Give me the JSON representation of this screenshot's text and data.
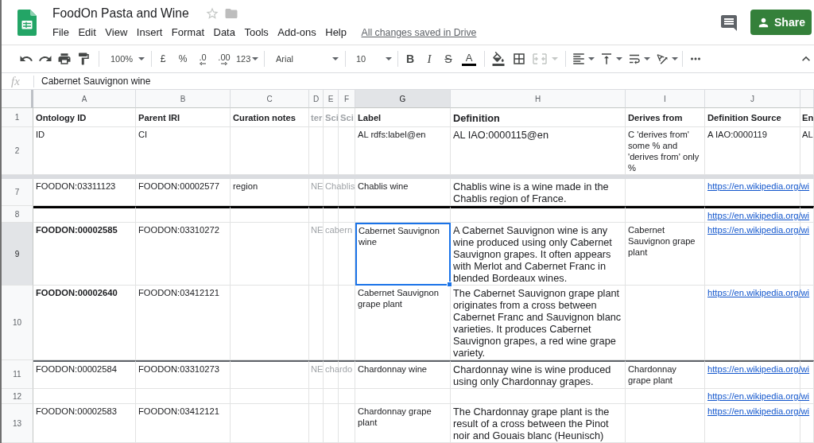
{
  "document": {
    "title": "FoodOn Pasta and Wine",
    "starred": false,
    "menu": [
      "File",
      "Edit",
      "View",
      "Insert",
      "Format",
      "Data",
      "Tools",
      "Add-ons",
      "Help"
    ],
    "save_status": "All changes saved in Drive"
  },
  "share_button": {
    "label": "Share"
  },
  "toolbar": {
    "zoom": "100%",
    "currency": "£",
    "percent": "%",
    "decrease_decimal": ".0",
    "increase_decimal": ".00",
    "number_format": "123",
    "font": "Arial",
    "font_size": "10",
    "bold": "B",
    "italic": "I",
    "strikethrough": "S",
    "text_color": "A",
    "merge_disabled": true
  },
  "formula_bar": {
    "label": "fx",
    "value": "Cabernet Sauvignon wine"
  },
  "sheet": {
    "columns": [
      {
        "letter": "A",
        "selected": false
      },
      {
        "letter": "B",
        "selected": false
      },
      {
        "letter": "C",
        "selected": false
      },
      {
        "letter": "D",
        "selected": false
      },
      {
        "letter": "E",
        "selected": false
      },
      {
        "letter": "F",
        "selected": false
      },
      {
        "letter": "G",
        "selected": true
      },
      {
        "letter": "H",
        "selected": false
      },
      {
        "letter": "I",
        "selected": false
      },
      {
        "letter": "J",
        "selected": false
      },
      {
        "selected": false
      }
    ],
    "rows": [
      {
        "number": "1",
        "selected": false,
        "kind": "header",
        "frozen_split_above": false,
        "heavy_border_above": false,
        "medium_border_above": false,
        "cells": {
          "a": "Ontology ID",
          "b": "Parent IRI",
          "c": "Curation notes",
          "d": {
            "text": "ter",
            "muted": true
          },
          "e": {
            "text": "Sci",
            "muted": true
          },
          "f": {
            "text": "Sci",
            "muted": true
          },
          "g": "Label",
          "h": "Definition",
          "i": "Derives from",
          "j": "Definition Source",
          "k": "En"
        }
      },
      {
        "number": "2",
        "selected": false,
        "kind": "data",
        "frozen_split_above": false,
        "heavy_border_above": false,
        "medium_border_above": false,
        "cells": {
          "a": "ID",
          "b": "CI",
          "g": "AL rdfs:label@en",
          "h": "AL IAO:0000115@en",
          "i": "C 'derives from' some % and 'derives from' only %",
          "j": "A IAO:0000119",
          "k": "AL"
        }
      },
      {
        "number": "7",
        "selected": false,
        "kind": "data",
        "frozen_split_above": true,
        "heavy_border_above": false,
        "medium_border_above": false,
        "cells": {
          "a": "FOODON:03311123",
          "b": "FOODON:00002577",
          "c": "region",
          "d": {
            "text": "NE",
            "muted": true
          },
          "e": {
            "text": "Chablis",
            "muted": true
          },
          "g": "Chablis wine",
          "h": "Chablis wine is a wine made in the Chablis region of France.",
          "j": {
            "text": "https://en.wikipedia.org/wi",
            "link": true
          }
        }
      },
      {
        "number": "8",
        "selected": false,
        "kind": "data",
        "frozen_split_above": false,
        "heavy_border_above": true,
        "medium_border_above": false,
        "cells": {
          "j": {
            "text": "https://en.wikipedia.org/wi",
            "link": true
          }
        }
      },
      {
        "number": "9",
        "selected": true,
        "kind": "data",
        "frozen_split_above": false,
        "heavy_border_above": false,
        "medium_border_above": false,
        "cells": {
          "a": {
            "text": "FOODON:00002585",
            "bold": true
          },
          "b": "FOODON:03310272",
          "d": {
            "text": "NE",
            "muted": true
          },
          "e": {
            "text": "cabern",
            "muted": true
          },
          "g": "Cabernet Sauvignon wine",
          "h": "A Cabernet Sauvignon wine is any wine produced using only Cabernet Sauvignon grapes. It often appears with Merlot and Cabernet Franc in blended Bordeaux wines.",
          "i": "Cabernet Sauvignon grape plant",
          "j": {
            "text": "https://en.wikipedia.org/wi",
            "link": true
          }
        }
      },
      {
        "number": "10",
        "selected": false,
        "kind": "data",
        "frozen_split_above": false,
        "heavy_border_above": false,
        "medium_border_above": false,
        "cells": {
          "a": {
            "text": "FOODON:00002640",
            "bold": true
          },
          "b": "FOODON:03412121",
          "g": "Cabernet Sauvignon grape plant",
          "h": "The Cabernet Sauvignon grape plant originates from a cross between Cabernet Franc and Sauvignon blanc varieties. It produces Cabernet Sauvignon grapes, a red wine grape variety.",
          "j": {
            "text": "https://en.wikipedia.org/wi",
            "link": true
          }
        }
      },
      {
        "number": "11",
        "selected": false,
        "kind": "data",
        "frozen_split_above": false,
        "heavy_border_above": false,
        "medium_border_above": true,
        "cells": {
          "a": "FOODON:00002584",
          "b": "FOODON:03310273",
          "d": {
            "text": "NE",
            "muted": true
          },
          "e": {
            "text": "chardo",
            "muted": true
          },
          "g": "Chardonnay wine",
          "h": "Chardonnay wine is wine produced using only Chardonnay grapes.",
          "i": "Chardonnay grape plant",
          "j": {
            "text": "https://en.wikipedia.org/wi",
            "link": true
          }
        }
      },
      {
        "number": "12",
        "selected": false,
        "kind": "data",
        "frozen_split_above": false,
        "heavy_border_above": false,
        "medium_border_above": false,
        "cells": {
          "j": {
            "text": "https://en.wikipedia.org/wi",
            "link": true
          }
        }
      },
      {
        "number": "13",
        "selected": false,
        "kind": "data",
        "frozen_split_above": false,
        "heavy_border_above": false,
        "medium_border_above": false,
        "cells": {
          "a": "FOODON:00002583",
          "b": "FOODON:03412121",
          "g": "Chardonnay grape plant",
          "h": "The Chardonnay grape plant is the result of a cross between the Pinot noir and Gouais blanc (Heunisch)",
          "j": {
            "text": "https://en.wikipedia.org/wi",
            "link": true
          }
        }
      }
    ]
  }
}
